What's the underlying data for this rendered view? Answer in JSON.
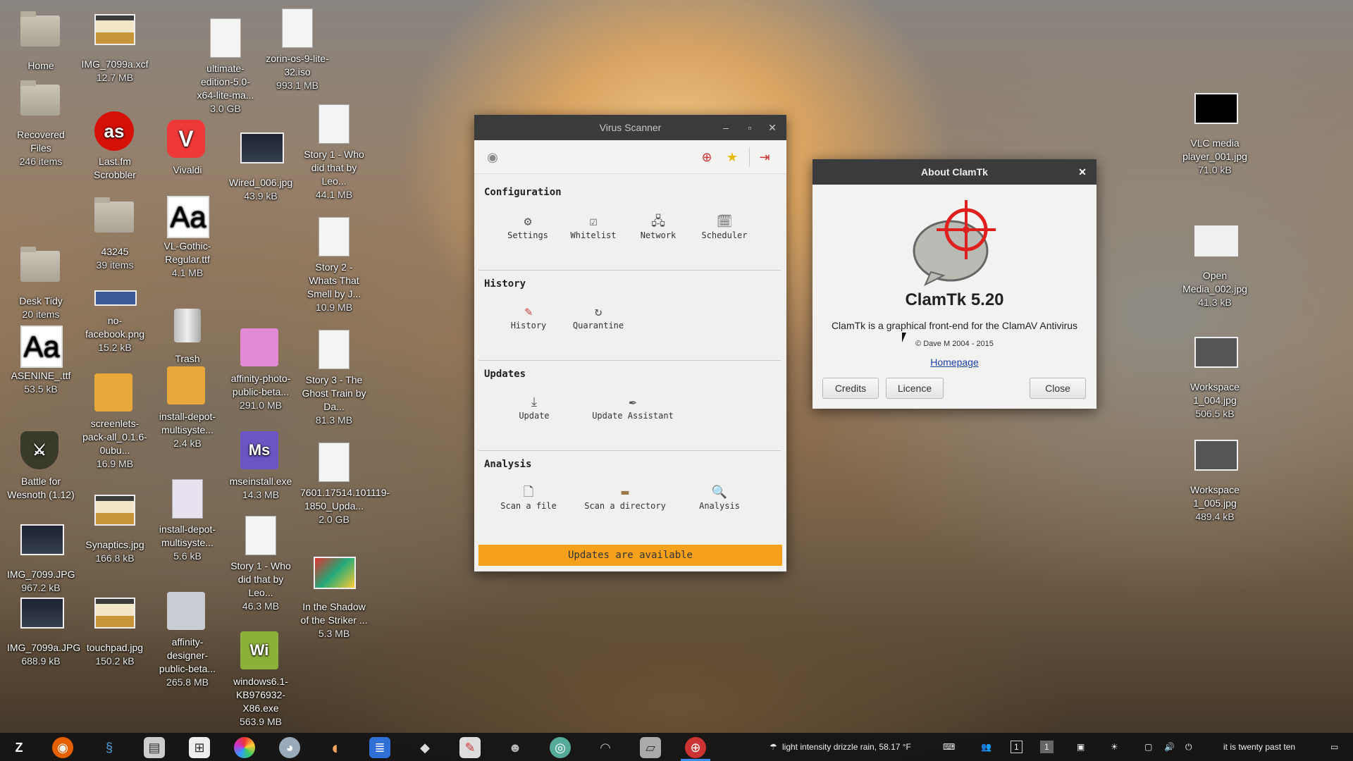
{
  "desktop": {
    "icons": [
      {
        "name": "Home",
        "size": ""
      },
      {
        "name": "Recovered Files",
        "size": "246 items"
      },
      {
        "name": "Desk Tidy",
        "size": "20 items"
      },
      {
        "name": "ASENINE_.ttf",
        "size": "53.5 kB"
      },
      {
        "name": "Battle for Wesnoth (1.12)",
        "size": ""
      },
      {
        "name": "IMG_7099.JPG",
        "size": "967.2 kB"
      },
      {
        "name": "IMG_7099a.JPG",
        "size": "688.9 kB"
      },
      {
        "name": "IMG_7099a.xcf",
        "size": "12.7 MB"
      },
      {
        "name": "Last.fm Scrobbler",
        "size": ""
      },
      {
        "name": "43245",
        "size": "39 items"
      },
      {
        "name": "no-facebook.png",
        "size": "15.2 kB"
      },
      {
        "name": "screenlets-pack-all_0.1.6-0ubu...",
        "size": "16.9 MB"
      },
      {
        "name": "Synaptics.jpg",
        "size": "166.8 kB"
      },
      {
        "name": "touchpad.jpg",
        "size": "150.2 kB"
      },
      {
        "name": "Vivaldi",
        "size": ""
      },
      {
        "name": "VL-Gothic-Regular.ttf",
        "size": "4.1 MB"
      },
      {
        "name": "Trash",
        "size": ""
      },
      {
        "name": "install-depot-multisyste...",
        "size": "2.4 kB"
      },
      {
        "name": "install-depot-multisyste...",
        "size": "5.6 kB"
      },
      {
        "name": "affinity-designer-public-beta...",
        "size": "265.8 MB"
      },
      {
        "name": "ultimate-edition-5.0-x64-lite-ma...",
        "size": "3.0 GB"
      },
      {
        "name": "Wired_006.jpg",
        "size": "43.9 kB"
      },
      {
        "name": "affinity-photo-public-beta...",
        "size": "291.0 MB"
      },
      {
        "name": "mseinstall.exe",
        "size": "14.3 MB"
      },
      {
        "name": "Story 1 - Who did that by Leo...",
        "size": "46.3 MB"
      },
      {
        "name": "windows6.1-KB976932-X86.exe",
        "size": "563.9 MB"
      },
      {
        "name": "zorin-os-9-lite-32.iso",
        "size": "993.1 MB"
      },
      {
        "name": "Story 1 - Who did that by Leo...",
        "size": "44.1 MB"
      },
      {
        "name": "Story 2 - Whats That Smell by J...",
        "size": "10.9 MB"
      },
      {
        "name": "Story 3 - The Ghost Train by Da...",
        "size": "81.3 MB"
      },
      {
        "name": "7601.17514.101119-1850_Upda...",
        "size": "2.0 GB"
      },
      {
        "name": "In the Shadow of the Striker ...",
        "size": "5.3 MB"
      },
      {
        "name": "VLC media player_001.jpg",
        "size": "71.0 kB"
      },
      {
        "name": "Open Media_002.jpg",
        "size": "41.3 kB"
      },
      {
        "name": "Workspace 1_004.jpg",
        "size": "506.5 kB"
      },
      {
        "name": "Workspace 1_005.jpg",
        "size": "489.4 kB"
      }
    ]
  },
  "scanner": {
    "title": "Virus Scanner",
    "sections": {
      "configuration": {
        "title": "Configuration",
        "items": [
          "Settings",
          "Whitelist",
          "Network",
          "Scheduler"
        ]
      },
      "history": {
        "title": "History",
        "items": [
          "History",
          "Quarantine"
        ]
      },
      "updates": {
        "title": "Updates",
        "items": [
          "Update",
          "Update Assistant"
        ]
      },
      "analysis": {
        "title": "Analysis",
        "items": [
          "Scan a file",
          "Scan a directory",
          "Analysis"
        ]
      }
    },
    "status": "Updates are available"
  },
  "about": {
    "title": "About ClamTk",
    "app_name": "ClamTk 5.20",
    "description": "ClamTk is a graphical front-end for the ClamAV Antivirus",
    "copyright": "© Dave M 2004 - 2015",
    "homepage": "Homepage",
    "credits": "Credits",
    "licence": "Licence",
    "close": "Close"
  },
  "taskbar": {
    "weather": "light intensity drizzle rain, 58.17 °F",
    "workspace_1": "1",
    "workspace_2": "1",
    "clock": "it is twenty past ten"
  },
  "colors": {
    "status_bar": "#f5a11c",
    "titlebar": "#3a3b3d",
    "clamtk_red": "#e0201e"
  }
}
